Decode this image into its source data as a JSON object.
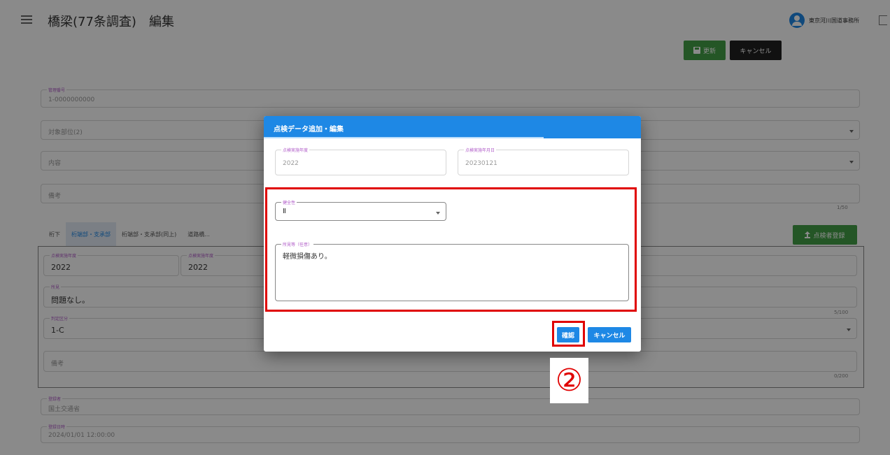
{
  "header": {
    "title": "橋梁(77条調査)　編集",
    "user_name": "東京河川国道事務所"
  },
  "actions": {
    "update_label": "更新",
    "cancel_label": "キャンセル"
  },
  "form": {
    "fields": [
      {
        "label": "管理番号",
        "value": "1-0000000000"
      },
      {
        "label": "対象部位(2)",
        "value": ""
      },
      {
        "label": "内容",
        "value": ""
      },
      {
        "label": "備考",
        "value": "",
        "counter": "1/50"
      }
    ],
    "tabs": [
      "桁下",
      "桁端部・支承部",
      "桁端部・支承部(同上)",
      "道路橋..."
    ],
    "register_label": "点検者登録",
    "panel_fields": [
      {
        "label": "点検実施年度",
        "value": "2022"
      },
      {
        "label": "点検実施年度",
        "value": "2022"
      },
      {
        "label": "所見",
        "value": "問題なし。",
        "counter": "5/100"
      },
      {
        "label": "判定区分",
        "value": "1-C"
      },
      {
        "label": "備考",
        "value": "",
        "counter": "0/200"
      }
    ],
    "bottom_fields": [
      {
        "label": "登録者",
        "value": "国土交通省"
      },
      {
        "label": "登録日時",
        "value": "2024/01/01 12:00:00"
      }
    ]
  },
  "dialog": {
    "title": "点検データ追加・編集",
    "year_label": "点検実施年度",
    "year_value": "2022",
    "date_label": "点検実施年月日",
    "date_value": "20230121",
    "judgement_label": "健全性",
    "judgement_value": "Ⅱ",
    "finding_label": "所見等（任意）",
    "finding_value": "軽微損傷あり。",
    "confirm_label": "確認",
    "cancel_label": "キャンセル"
  },
  "annotation": {
    "step": "②",
    "color": "#e00000"
  }
}
